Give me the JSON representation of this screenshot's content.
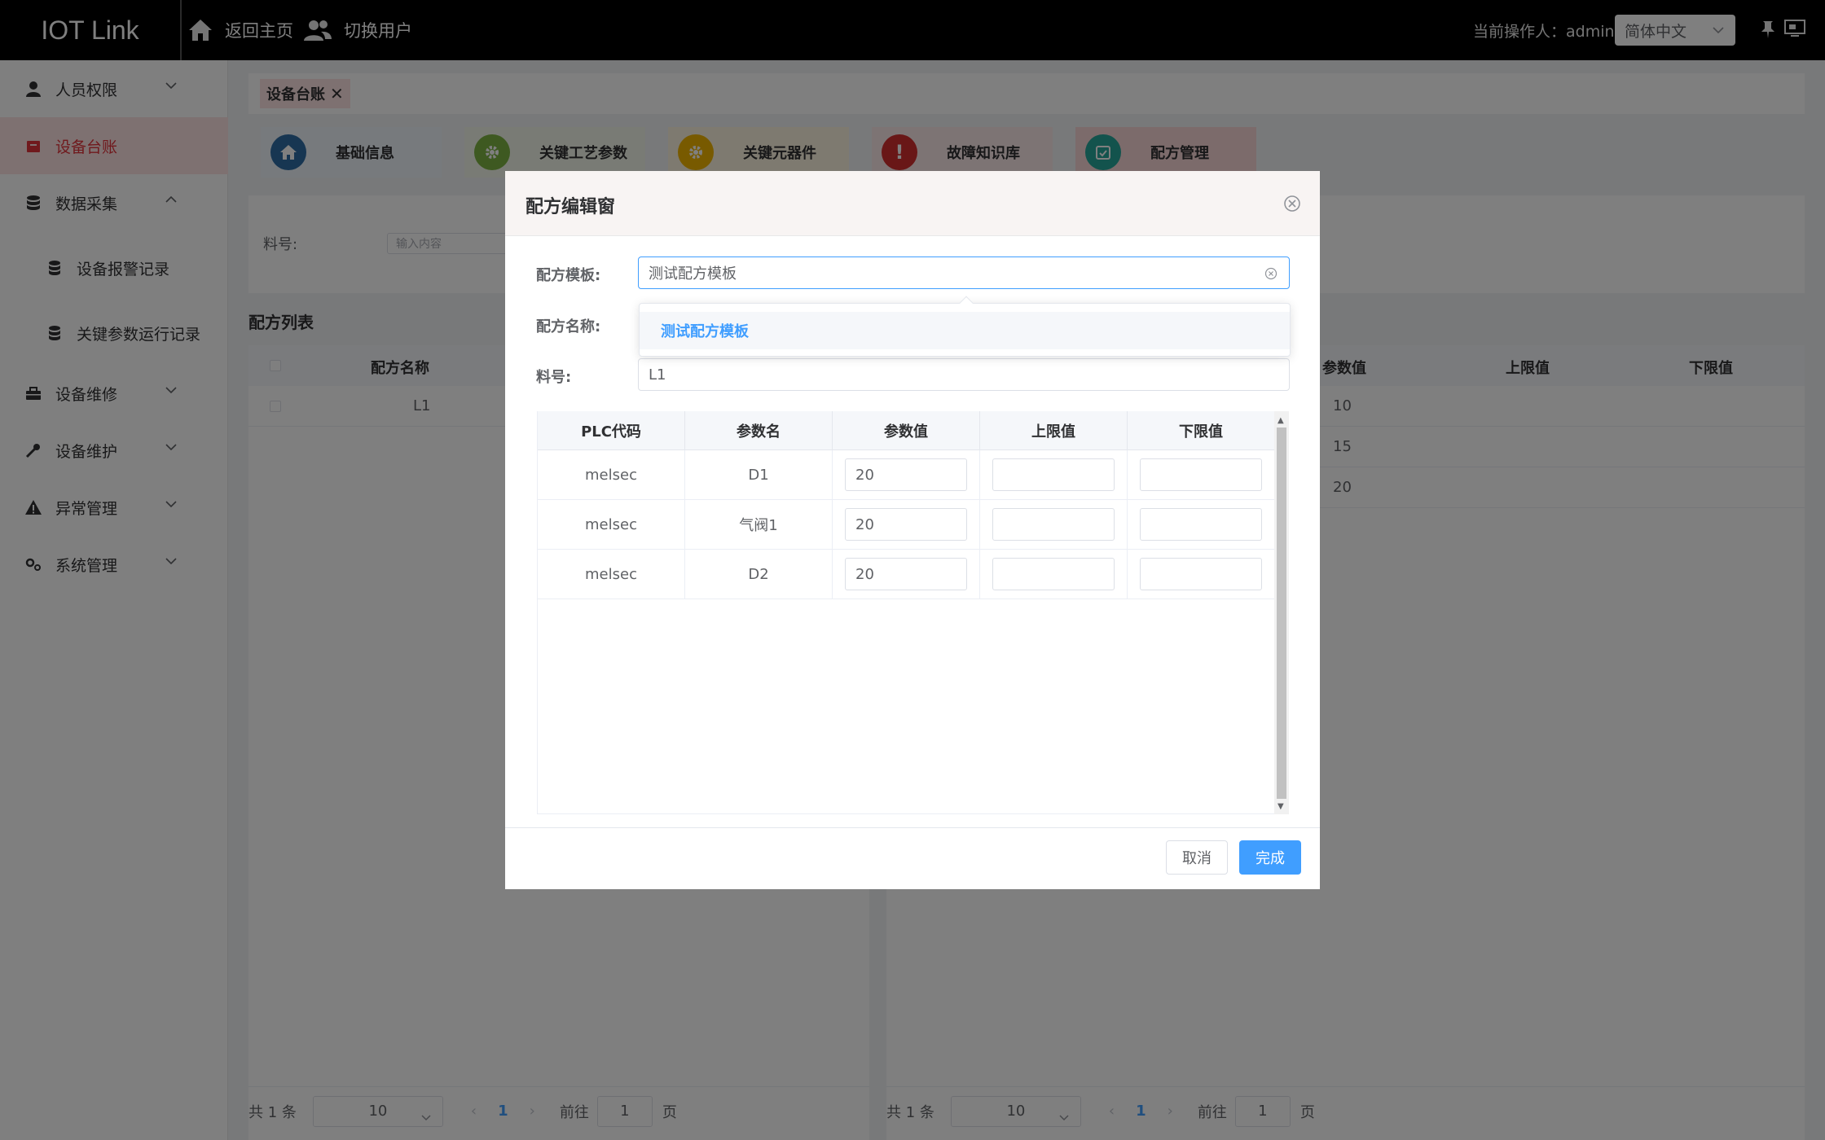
{
  "header": {
    "logo": "IOT Link",
    "home_label": "返回主页",
    "switch_user_label": "切换用户",
    "operator_label": "当前操作人：",
    "operator_name": "admin",
    "language": "简体中文"
  },
  "sidebar": {
    "items": [
      {
        "label": "人员权限"
      },
      {
        "label": "设备台账"
      },
      {
        "label": "数据采集"
      },
      {
        "label": "设备报警记录"
      },
      {
        "label": "关键参数运行记录"
      },
      {
        "label": "设备维修"
      },
      {
        "label": "设备维护"
      },
      {
        "label": "异常管理"
      },
      {
        "label": "系统管理"
      }
    ]
  },
  "main": {
    "tag_label": "设备台账",
    "tabs": [
      {
        "label": "基础信息",
        "color": "#2e6da4"
      },
      {
        "label": "关键工艺参数",
        "color": "#7cb342"
      },
      {
        "label": "关键元器件",
        "color": "#f0b400"
      },
      {
        "label": "故障知识库",
        "color": "#d32f2f"
      },
      {
        "label": "配方管理",
        "color": "#26a69a"
      }
    ],
    "filter_label": "料号:",
    "filter_placeholder": "输入内容",
    "list_title": "配方列表",
    "left_table": {
      "header": "配方名称",
      "rows": [
        "L1"
      ]
    },
    "right_table": {
      "headers": [
        "参数值",
        "上限值",
        "下限值"
      ],
      "values": [
        "10",
        "15",
        "20"
      ]
    },
    "pagination": {
      "total": "共 1 条",
      "page_size": "10",
      "current_page": "1",
      "goto_label": "前往",
      "goto_value": "1",
      "page_unit": "页"
    }
  },
  "dialog": {
    "title": "配方编辑窗",
    "template_label": "配方模板:",
    "template_value": "测试配方模板",
    "dropdown_option": "测试配方模板",
    "name_label": "配方名称:",
    "part_label": "料号:",
    "part_value": "L1",
    "table_headers": [
      "PLC代码",
      "参数名",
      "参数值",
      "上限值",
      "下限值"
    ],
    "rows": [
      {
        "plc": "melsec",
        "name": "D1",
        "value": "20",
        "upper": "",
        "lower": ""
      },
      {
        "plc": "melsec",
        "name": "气阀1",
        "value": "20",
        "upper": "",
        "lower": ""
      },
      {
        "plc": "melsec",
        "name": "D2",
        "value": "20",
        "upper": "",
        "lower": ""
      }
    ],
    "cancel_label": "取消",
    "done_label": "完成"
  },
  "colors": {
    "accent": "#409eff",
    "sidebar_active_bg": "#fde2e2",
    "sidebar_active_text": "#e0323a"
  }
}
